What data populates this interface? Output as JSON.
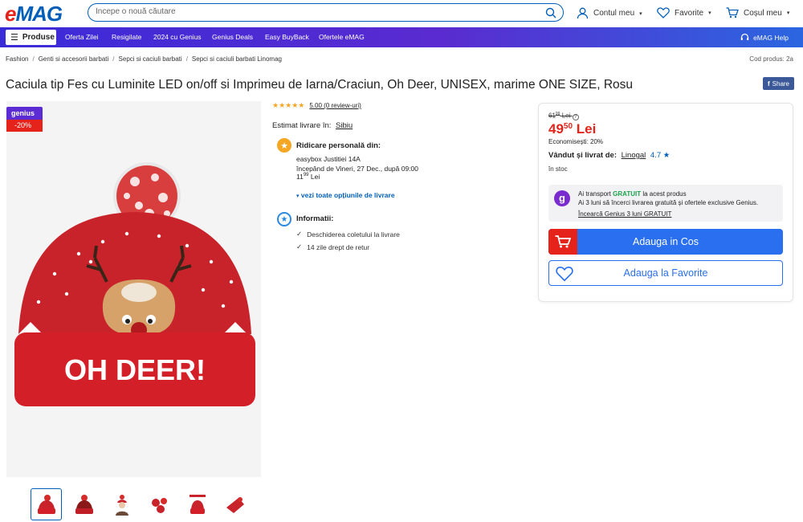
{
  "header": {
    "logo": "eMAG",
    "search_placeholder": "Începe o nouă căutare",
    "account": "Contul meu",
    "favorites": "Favorite",
    "cart": "Coșul meu"
  },
  "nav": {
    "products": "Produse",
    "items": [
      "Oferta Zilei",
      "Resigilate",
      "2024 cu Genius",
      "Genius Deals",
      "Easy BuyBack",
      "Ofertele eMAG"
    ],
    "help": "eMAG Help"
  },
  "breadcrumb": [
    "Fashion",
    "Genti si accesorii barbati",
    "Sepci si caciuli barbati",
    "Sepci si caciuli barbati Linomag"
  ],
  "product_code": "Cod produs: 2a",
  "title": "Caciula tip Fes cu Luminite LED on/off si Imprimeu de Iarna/Craciun, Oh Deer, UNISEX, marime ONE SIZE, Rosu",
  "share": "Share",
  "badges": {
    "genius": "genius",
    "discount": "-20%"
  },
  "image": {
    "text": "OH DEER!"
  },
  "rating": {
    "stars": "★★★★★",
    "text": "5.00 (0 review-uri)"
  },
  "delivery": {
    "estimate_label": "Estimat livrare în:",
    "city": "Sibiu",
    "pickup_title": "Ridicare personală din:",
    "pickup_location": "easybox Justitiei 14A",
    "pickup_time": "începând de Vineri, 27 Dec., după 09:00",
    "pickup_price_int": "11",
    "pickup_price_dec": "99",
    "pickup_price_cur": "Lei",
    "all_options": "vezi toate opțiunile de livrare"
  },
  "info": {
    "title": "Informatii:",
    "items": [
      "Deschiderea coletului la livrare",
      "14 zile drept de retur"
    ]
  },
  "buy": {
    "old_int": "61",
    "old_dec": "99",
    "old_cur": "Lei",
    "price_int": "49",
    "price_dec": "50",
    "price_cur": "Lei",
    "economy": "Economisești: 20%",
    "sold_label": "Vândut și livrat de:",
    "seller": "Linogal",
    "seller_rating": "4.7 ★",
    "stock": "în stoc",
    "genius_line1_pre": "Ai transport",
    "genius_line1_green": "GRATUIT",
    "genius_line1_post": "la acest produs",
    "genius_line2": "Ai 3 luni să încerci livrarea gratuită și ofertele exclusive Genius.",
    "genius_try": "Încearcă Genius 3 luni GRATUIT",
    "add_cart": "Adauga in Cos",
    "add_fav": "Adauga la Favorite"
  },
  "colors": {
    "brand_blue": "#005eb8",
    "brand_red": "#e5231b",
    "genius_purple": "#5b2bd3",
    "button_blue": "#2a6ff0"
  }
}
